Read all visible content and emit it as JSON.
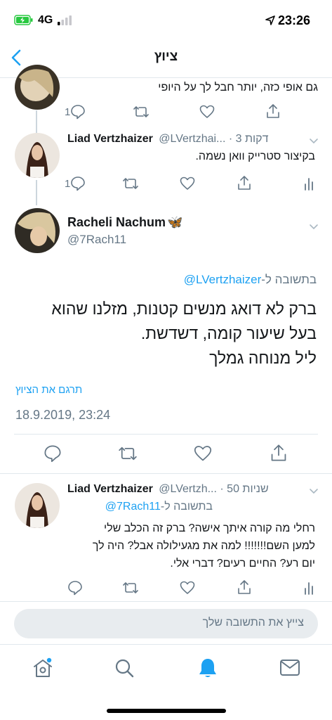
{
  "status": {
    "network": "4G",
    "time": "23:26"
  },
  "nav": {
    "title": "ציוץ"
  },
  "prev_tweet": {
    "text": "גם אופי כזה, יותר חבל לך על היופי",
    "reply_count": "1"
  },
  "tweet_a": {
    "name": "Liad Vertzhaizer",
    "handle": "@LVertzhai...",
    "time": "3 דקות",
    "text": "בקיצור סטרייק וואן נשמה.",
    "reply_count": "1"
  },
  "main_tweet": {
    "name": "Racheli Nachum",
    "name_emoji": "🦋",
    "handle": "@7Rach11",
    "reply_prefix": "בתשובה ל-",
    "reply_to": "@LVertzhaizer",
    "lines": [
      "ברק לא דואג מנשים קטנות, מזלנו שהוא",
      "בעל שיעור קומה, דשדשת.",
      "ליל מנוחה גמלך"
    ],
    "translate": "תרגם את הציוץ",
    "datetime": "18.9.2019, 23:24"
  },
  "tweet_b": {
    "name": "Liad Vertzhaizer",
    "handle": "@LVertzh...",
    "time": "50 שניות",
    "reply_prefix": "בתשובה ל-",
    "reply_to": "@7Rach11",
    "lines": [
      "רחלי מה קורה איתך אישה? ברק זה הכלב שלי",
      "למען השם!!!!!!! למה את מגעילולה אבל? היה לך",
      "יום רע? החיים רעים? דברי אלי."
    ]
  },
  "reply_box": {
    "placeholder": "צייץ את התשובה שלך"
  },
  "colors": {
    "accent": "#1da1f2",
    "secondary_text": "#657786",
    "border": "#e1e8ed"
  },
  "tabbar": {
    "icons": [
      "home-icon",
      "search-icon",
      "notifications-icon",
      "messages-icon"
    ]
  }
}
